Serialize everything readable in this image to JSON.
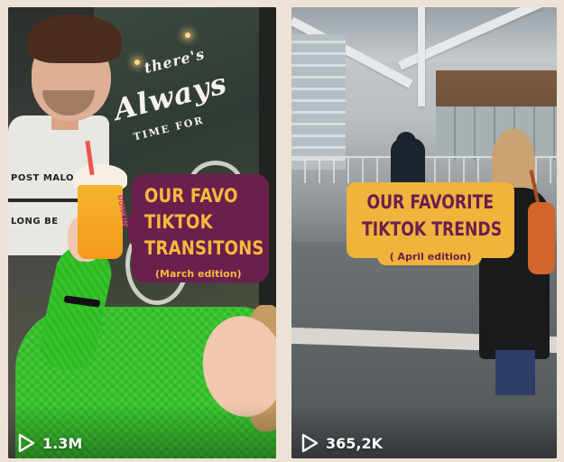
{
  "videos": [
    {
      "caption_lines": [
        "OUR FAVO",
        "TIKTOK",
        "TRANSITONS"
      ],
      "subtitle": "(March edition)",
      "views": "1.3M",
      "window_text": [
        "there's",
        "Always",
        "TIME FOR"
      ],
      "shirt_text": [
        "POST MALONE",
        "LONG BE"
      ],
      "cup_text": "DUNKIN'",
      "caption_bg_color": "#6b1f4d",
      "caption_text_color": "#f8b93d"
    },
    {
      "caption_lines": [
        "OUR FAVORITE",
        "TIKTOK TRENDS"
      ],
      "subtitle": "( April edition)",
      "views": "365,2K",
      "caption_bg_color": "#f0b33b",
      "caption_text_color": "#6b1f4d"
    }
  ],
  "icons": {
    "play": "play-icon"
  }
}
